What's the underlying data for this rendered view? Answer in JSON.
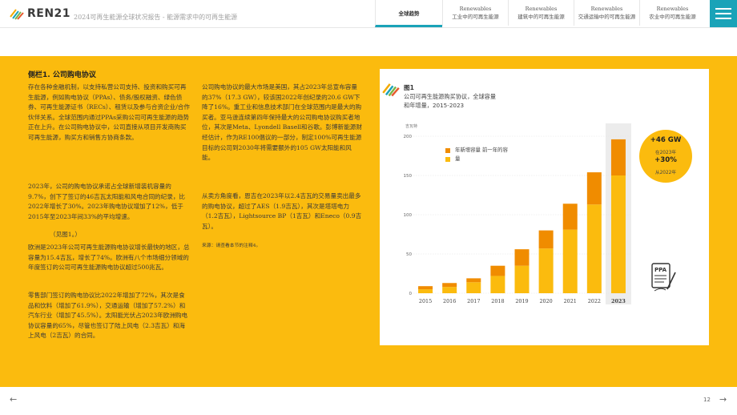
{
  "header": {
    "logo_text": "REN21",
    "doc_title": "2024可再生能源全球状况报告 - 能源需求中的可再生能源",
    "tabs": [
      {
        "line1": "",
        "line2": "全球趋势",
        "active": true
      },
      {
        "line1": "Renewables",
        "line2": "工业中的可再生能源",
        "active": false
      },
      {
        "line1": "Renewables",
        "line2": "建筑中的可再生能源",
        "active": false
      },
      {
        "line1": "Renewables",
        "line2": "交通运输中的可再生能源",
        "active": false
      },
      {
        "line1": "Renewables",
        "line2": "农业中的可再生能源",
        "active": false
      }
    ]
  },
  "sidebar": {
    "title": "侧栏1. 公司购电协议",
    "col1": [
      "存在各种金融机制，以支持私营公司支持、投资和购买可再生能源，例如购电协议（PPAs）、债务/股权融资、绿色债券、可再生能源证书（RECs）、租赁以及参与合资企业/合作伙伴关系。全球范围内通过PPAs采购公司可再生能源的趋势正在上升。在公司购电协议中，公司直接从项目开发商购买可再生能源，购买方和销售方协商条款。",
      "2023年，公司的购电协议承诺占全球新增装机容量的9.7%，创下了签订的46吉瓦太阳能和风电合同的纪录，比2022年增长了30%。2023年购电协议增加了12%，低于2015年至2023年间33%的平均增速。",
      "（见图1。）",
      "欧洲是2023年公司可再生能源购电协议增长最快的地区，总容量为15.4吉瓦，增长了74%。欧洲有八个市场细分领域的年度签订的公司可再生能源购电协议超过500兆瓦。",
      "零售部门签订的购电协议比2022年增加了72%，其次是食品和饮料（增加了61.9%），交通运输（增加了57.2%）和汽车行业（增加了45.5%）。太阳能光伏占2023年欧洲购电协议容量的65%，尽管也签订了陆上风电（2.3吉瓦）和海上风电（2吉瓦）的合同。"
    ],
    "col2": [
      "公司购电协议的最大市场是美国，其占2023年总宣布容量的37%（17.3 GW），较该国2022年创纪录的20.6 GW下降了16%。重工业和信息技术部门在全球范围内是最大的购买者。亚马逊连续第四年保持最大的公司购电协议购买者地位，其次是Meta、Lyondell Basell和谷歌。彭博新能源财经估计，作为RE100倡议的一部分，制定100%可再生能源目标的公司到2030年将需要额外的105 GW太阳能和风能。",
      "从卖方角度看，恩吉在2023年以2.4吉瓦的交易量卖出最多的购电协议，超过了AES（1.9吉瓦），其次是塔塔电力（1.2吉瓦），Lightsource BP（1吉瓦）和Eneco（0.9吉瓦）。"
    ],
    "source": "来源：请查看本节的注释4。"
  },
  "figure": {
    "label": "图1",
    "title_line1": "公司可再生能源购买协议，全球容量",
    "title_line2": "和年增量，2015-2023",
    "unit": "吉瓦特",
    "callout": {
      "value": "+46 GW",
      "line1": "在2023年",
      "pct": "+30%",
      "line2": "从2022年"
    },
    "ppa_text": "PPA"
  },
  "chart_data": {
    "type": "bar",
    "stacked": true,
    "categories": [
      "2015",
      "2016",
      "2017",
      "2018",
      "2019",
      "2020",
      "2021",
      "2022",
      "2023"
    ],
    "series": [
      {
        "name": "量",
        "color": "#fbbb0e",
        "values": [
          5,
          8,
          14,
          22,
          35,
          57,
          81,
          113,
          150
        ]
      },
      {
        "name": "年新增容量 前一年的容",
        "color": "#f08c00",
        "values": [
          4,
          5,
          5,
          13,
          21,
          23,
          33,
          41,
          46
        ]
      }
    ],
    "ylim": [
      0,
      200
    ],
    "yticks": [
      0,
      50,
      100,
      150,
      200
    ],
    "highlight_category": "2023",
    "grid": true,
    "legend_position": "top-left"
  },
  "footer": {
    "prev_arrow": "←",
    "page": "12",
    "next_arrow": "→"
  }
}
